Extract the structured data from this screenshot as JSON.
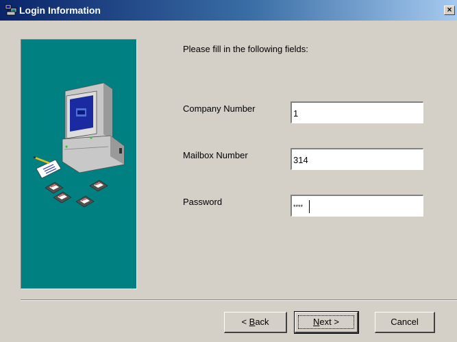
{
  "window": {
    "title": "Login Information",
    "app_icon": "network-computer-icon",
    "close_glyph": "×"
  },
  "illustration": {
    "subject": "computer-with-diskettes",
    "background": "#008080"
  },
  "form": {
    "instruction": "Please fill in the following fields:",
    "fields": [
      {
        "label": "Company Number",
        "value": "1"
      },
      {
        "label": "Mailbox Number",
        "value": "314"
      },
      {
        "label": "Password",
        "value": "****"
      }
    ]
  },
  "buttons": {
    "back": {
      "pre": "< ",
      "mnemonic": "B",
      "rest": "ack"
    },
    "next": {
      "mnemonic": "N",
      "rest": "ext >"
    },
    "cancel": {
      "label": "Cancel"
    }
  },
  "colors": {
    "titlebar_start": "#0a246a",
    "titlebar_end": "#a6caf0",
    "face": "#d4d0c8"
  }
}
